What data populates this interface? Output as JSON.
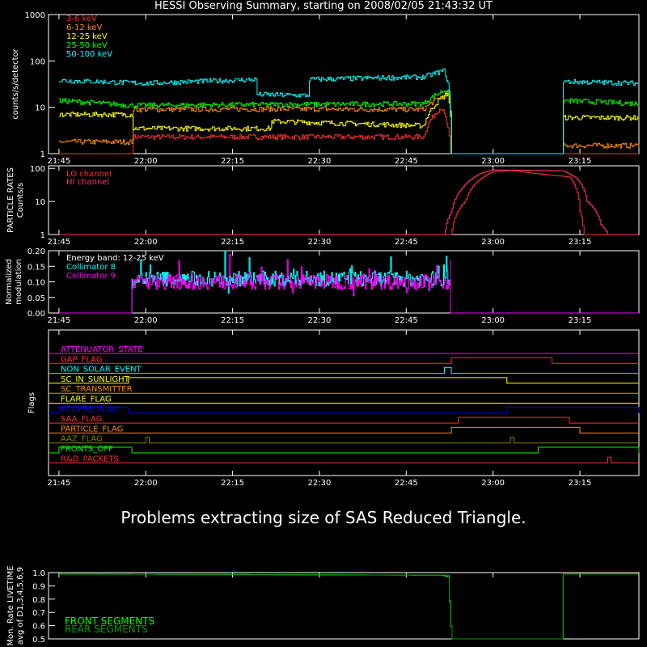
{
  "title": "HESSI Observing Summary, starting on 2008/02/05 21:43:32 UT",
  "message": "Problems extracting size of SAS Reduced Triangle.",
  "time_ticks": [
    "21:45",
    "22:00",
    "22:15",
    "22:30",
    "22:45",
    "23:00",
    "23:15"
  ],
  "colors": {
    "e3_6": "#ff3030",
    "e6_12": "#ff8c00",
    "e12_25": "#ffff00",
    "e25_50": "#00ff00",
    "e50_100": "#00ffff",
    "lo": "#ff3030",
    "hi": "#ff3070",
    "coll8": "#00ffff",
    "coll9": "#ff00ff",
    "front": "#00ff00",
    "rear": "#00a000"
  },
  "chart_data": [
    {
      "type": "line",
      "name": "count_rates",
      "ylabel": "counts/s/detector",
      "yscale": "log",
      "ylim": [
        1,
        1000
      ],
      "yticks": [
        "1",
        "10",
        "100",
        "1000"
      ],
      "legend_placement": "top-left",
      "series": [
        {
          "name": "3-6 keV",
          "color": "#ff3030",
          "profile": [
            [
              21.75,
              0
            ],
            [
              21.96,
              0
            ],
            [
              21.96,
              2.3
            ],
            [
              22.8,
              2.3
            ],
            [
              22.85,
              10
            ],
            [
              22.88,
              0
            ]
          ]
        },
        {
          "name": "6-12 keV",
          "color": "#ff8c00",
          "profile": [
            [
              21.75,
              1.8
            ],
            [
              21.96,
              1.8
            ],
            [
              21.96,
              9
            ],
            [
              22.35,
              9.2
            ],
            [
              22.8,
              9
            ],
            [
              22.87,
              20
            ],
            [
              22.88,
              0
            ],
            [
              23.2,
              0
            ],
            [
              23.2,
              1.5
            ],
            [
              23.42,
              1.5
            ]
          ]
        },
        {
          "name": "12-25 keV",
          "color": "#ffff00",
          "profile": [
            [
              21.75,
              7
            ],
            [
              21.96,
              7
            ],
            [
              21.96,
              3.5
            ],
            [
              22.36,
              3.5
            ],
            [
              22.36,
              5
            ],
            [
              22.8,
              4
            ],
            [
              22.87,
              20
            ],
            [
              22.88,
              0
            ],
            [
              23.2,
              0
            ],
            [
              23.2,
              6
            ],
            [
              23.42,
              6
            ]
          ]
        },
        {
          "name": "25-50 keV",
          "color": "#00ff00",
          "profile": [
            [
              21.75,
              14
            ],
            [
              21.96,
              11
            ],
            [
              22.35,
              11.5
            ],
            [
              22.8,
              12
            ],
            [
              22.87,
              25
            ],
            [
              22.88,
              0
            ],
            [
              23.2,
              0
            ],
            [
              23.2,
              14
            ],
            [
              23.42,
              12
            ]
          ]
        },
        {
          "name": "50-100 keV",
          "color": "#00ffff",
          "profile": [
            [
              21.75,
              38
            ],
            [
              22.0,
              33
            ],
            [
              22.32,
              40
            ],
            [
              22.32,
              19
            ],
            [
              22.47,
              18
            ],
            [
              22.47,
              40
            ],
            [
              22.8,
              45
            ],
            [
              22.86,
              62
            ],
            [
              22.88,
              0
            ],
            [
              23.2,
              0
            ],
            [
              23.2,
              36
            ],
            [
              23.42,
              33
            ]
          ]
        }
      ]
    },
    {
      "type": "line",
      "name": "particle_rates",
      "ylabel": "PARTICLE RATES Counts/s",
      "yscale": "log",
      "ylim": [
        1,
        120
      ],
      "yticks": [
        "1",
        "10",
        "100"
      ],
      "legend_placement": "top-left",
      "series": [
        {
          "name": "LO channel",
          "color": "#ff3030",
          "profile": [
            [
              21.75,
              1
            ],
            [
              22.88,
              1
            ],
            [
              22.92,
              10
            ],
            [
              22.96,
              45
            ],
            [
              23.0,
              80
            ],
            [
              23.05,
              88
            ],
            [
              23.12,
              70
            ],
            [
              23.22,
              55
            ],
            [
              23.25,
              5
            ],
            [
              23.26,
              1
            ],
            [
              23.42,
              1
            ]
          ]
        },
        {
          "name": "HI channel",
          "color": "#ff3070",
          "profile": [
            [
              21.75,
              1
            ],
            [
              22.86,
              1
            ],
            [
              22.88,
              5
            ],
            [
              22.91,
              25
            ],
            [
              22.97,
              75
            ],
            [
              23.0,
              90
            ],
            [
              23.2,
              85
            ],
            [
              23.24,
              50
            ],
            [
              23.27,
              10
            ],
            [
              23.31,
              2
            ],
            [
              23.33,
              1
            ],
            [
              23.42,
              1
            ]
          ]
        }
      ]
    },
    {
      "type": "line",
      "name": "modulation",
      "ylabel": "Normalized modulation",
      "ylim": [
        0,
        0.2
      ],
      "yticks": [
        "0.00",
        "0.05",
        "0.10",
        "0.15",
        "0.20"
      ],
      "annotation": "Energy band: 12-25 keV",
      "series": [
        {
          "name": "Collimator 8",
          "color": "#00ffff",
          "start": 21.96,
          "end": 22.88,
          "mean": 0.11
        },
        {
          "name": "Collimator 9",
          "color": "#ff00ff",
          "start": 21.96,
          "end": 22.88,
          "mean": 0.1
        }
      ]
    },
    {
      "type": "line",
      "name": "flags",
      "ylabel": "Flags",
      "flags": [
        {
          "name": "ATTENUATOR_STATE",
          "color": "#ff00ff",
          "on": []
        },
        {
          "name": "GAP_FLAG",
          "color": "#ff3030",
          "on": [
            [
              22.88,
              23.17
            ]
          ]
        },
        {
          "name": "NON_SOLAR_EVENT",
          "color": "#00ffff",
          "on": [
            [
              22.86,
              22.88
            ]
          ]
        },
        {
          "name": "SC_IN_SUNLIGHT",
          "color": "#ffff00",
          "on": [
            [
              21.95,
              23.04
            ]
          ]
        },
        {
          "name": "SC_TRANSMITTER",
          "color": "#ff8c00",
          "on": []
        },
        {
          "name": "FLARE_FLAG",
          "color": "#ffff00",
          "on": []
        },
        {
          "name": "ECLIPSE_FLAG",
          "color": "#0000ff",
          "on": [
            [
              21.75,
              21.95
            ],
            [
              23.04,
              23.42
            ]
          ]
        },
        {
          "name": "SAA_FLAG",
          "color": "#ff3030",
          "on": [
            [
              22.9,
              23.22
            ]
          ]
        },
        {
          "name": "PARTICLE_FLAG",
          "color": "#ff8c00",
          "on": [
            [
              22.88,
              23.25
            ]
          ]
        },
        {
          "name": "AAZ_FLAG",
          "color": "#808000",
          "on": [
            [
              22.0,
              22.01
            ],
            [
              23.05,
              23.06
            ]
          ]
        },
        {
          "name": "FRONTS_OFF",
          "color": "#00ff00",
          "on": [
            [
              21.75,
              21.96
            ],
            [
              23.13,
              23.42
            ]
          ]
        },
        {
          "name": "R&D_PACKETS",
          "color": "#ff3030",
          "on": [
            [
              23.33,
              23.34
            ]
          ]
        }
      ]
    },
    {
      "type": "line",
      "name": "livetime",
      "ylabel": "Mon. Rate LIVETIME avg of D1,3,4,5,6,9",
      "ylim": [
        0.5,
        1.0
      ],
      "yticks": [
        "0.5",
        "0.6",
        "0.7",
        "0.8",
        "0.9",
        "1.0"
      ],
      "legend_placement": "bottom-left",
      "series": [
        {
          "name": "FRONT SEGMENTS",
          "color": "#00ff00",
          "profile": [
            [
              21.75,
              0.99
            ],
            [
              22.85,
              0.98
            ],
            [
              22.87,
              0.97
            ],
            [
              22.88,
              0.5
            ],
            [
              23.2,
              0.5
            ],
            [
              23.2,
              0.99
            ],
            [
              23.42,
              0.99
            ]
          ]
        },
        {
          "name": "REAR SEGMENTS",
          "color": "#00a000",
          "profile": [
            [
              21.75,
              0.99
            ],
            [
              22.87,
              0.98
            ],
            [
              22.88,
              0.5
            ],
            [
              23.2,
              0.5
            ],
            [
              23.2,
              0.99
            ],
            [
              23.42,
              0.99
            ]
          ]
        }
      ]
    }
  ]
}
